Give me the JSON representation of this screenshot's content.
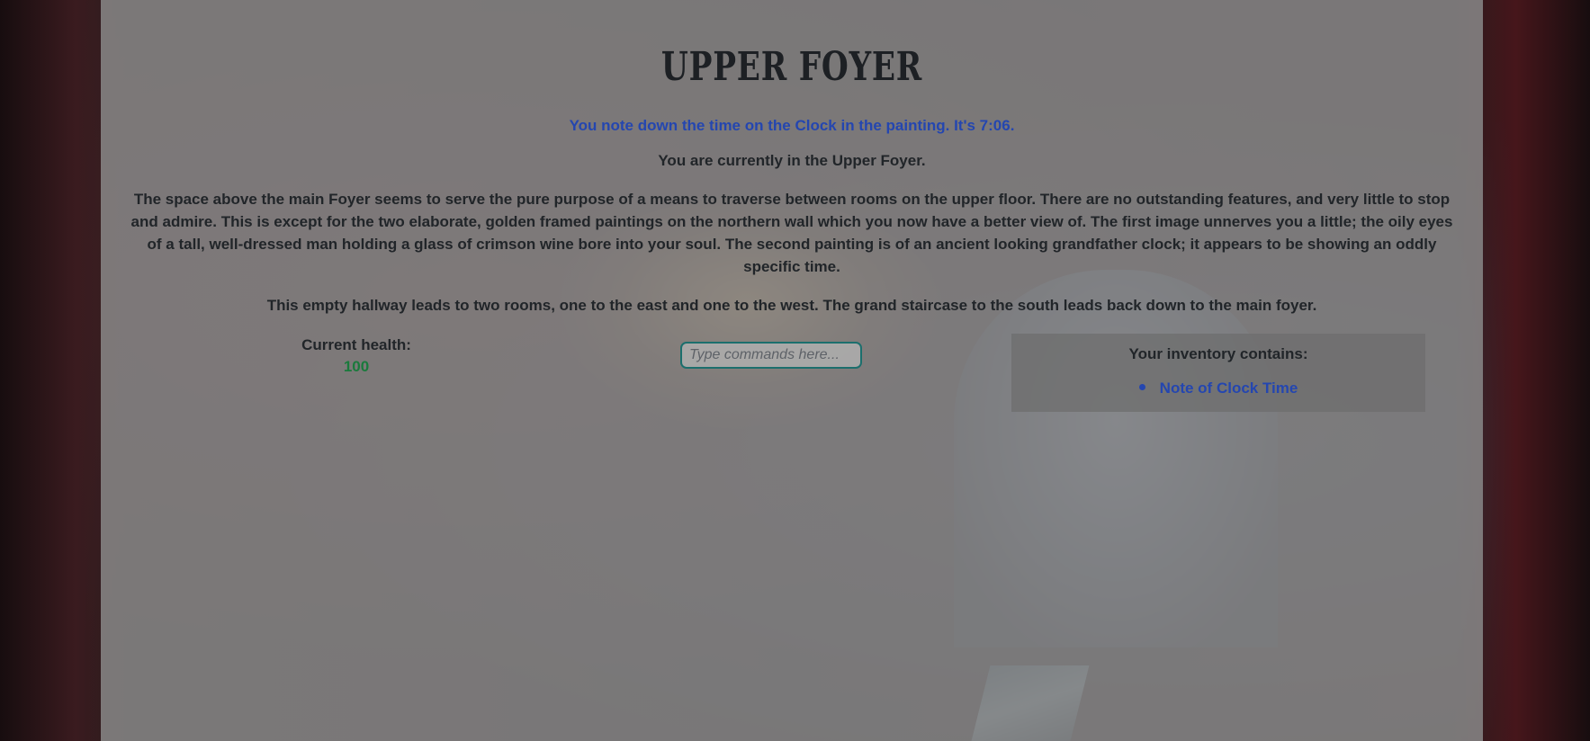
{
  "room": {
    "title": "Upper Foyer",
    "notice": "You note down the time on the Clock in the painting. It's 7:06.",
    "location": "You are currently in the Upper Foyer.",
    "description": "The space above the main Foyer seems to serve the pure purpose of a means to traverse between rooms on the upper floor. There are no outstanding features, and very little to stop and admire. This is except for the two elaborate, golden framed paintings on the northern wall which you now have a better view of. The first image unnerves you a little; the oily eyes of a tall, well-dressed man holding a glass of crimson wine bore into your soul. The second painting is of an ancient looking grandfather clock; it appears to be showing an oddly specific time.",
    "exits": "This empty hallway leads to two rooms, one to the east and one to the west. The grand staircase to the south leads back down to the main foyer."
  },
  "status": {
    "health_label": "Current health:",
    "health_value": "100"
  },
  "command": {
    "placeholder": "Type commands here..."
  },
  "inventory": {
    "title": "Your inventory contains:",
    "items": [
      "Note of Clock Time"
    ]
  },
  "colors": {
    "notice": "#2446b0",
    "health": "#1a7a3c",
    "input_border": "#1c6f6d"
  }
}
